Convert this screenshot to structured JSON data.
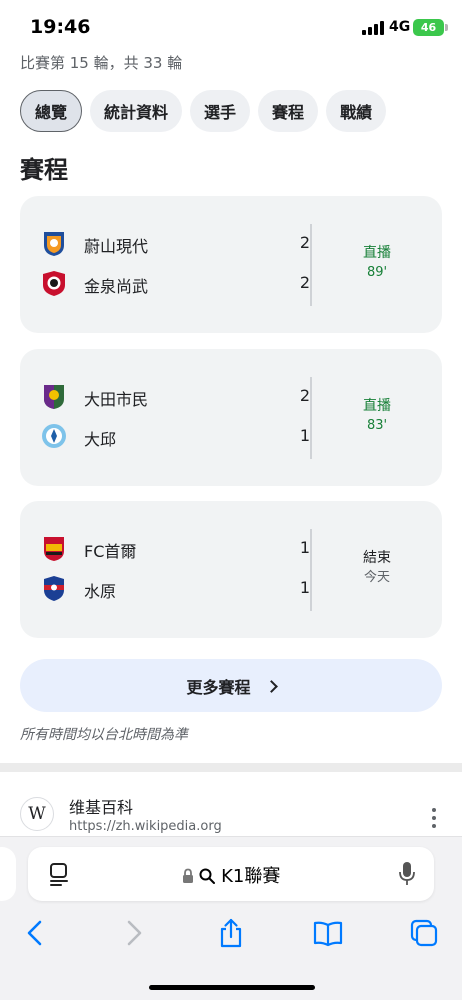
{
  "status_bar": {
    "time": "19:46",
    "network": "4G",
    "battery": "46"
  },
  "round_info": "比賽第 15 輪，共 33 輪",
  "tabs": [
    {
      "label": "總覽",
      "active": true
    },
    {
      "label": "統計資料",
      "active": false
    },
    {
      "label": "選手",
      "active": false
    },
    {
      "label": "賽程",
      "active": false
    },
    {
      "label": "戰績",
      "active": false
    }
  ],
  "section_title": "賽程",
  "matches": [
    {
      "home": {
        "name": "蔚山現代",
        "score": "2"
      },
      "away": {
        "name": "金泉尚武",
        "score": "2"
      },
      "status": "直播",
      "time": "89'",
      "live": true
    },
    {
      "home": {
        "name": "大田市民",
        "score": "2"
      },
      "away": {
        "name": "大邱",
        "score": "1"
      },
      "status": "直播",
      "time": "83'",
      "live": true
    },
    {
      "home": {
        "name": "FC首爾",
        "score": "1"
      },
      "away": {
        "name": "水原",
        "score": "1"
      },
      "status": "結束",
      "time": "今天",
      "live": false
    }
  ],
  "more_button": "更多賽程",
  "timezone_note": "所有時間均以台北時間為準",
  "wiki": {
    "icon_letter": "W",
    "title": "维基百科",
    "url": "https://zh.wikipedia.org"
  },
  "address_bar": {
    "query": "K1聯賽"
  },
  "colors": {
    "live": "#188038",
    "accent_bg": "#e8effd",
    "card_bg": "#f1f3f4",
    "ios_blue": "#007aff"
  }
}
